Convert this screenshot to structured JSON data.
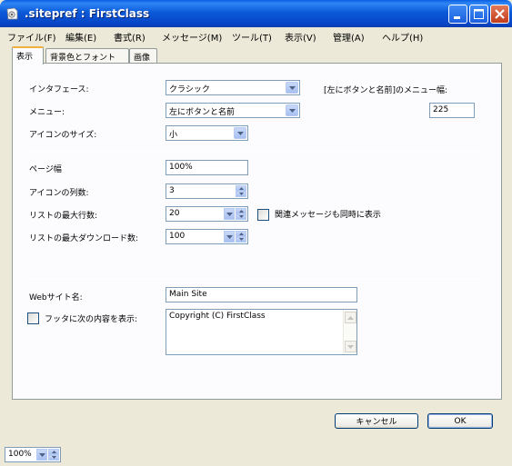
{
  "window": {
    "title": ".sitepref : FirstClass"
  },
  "menu": [
    "ファイル(F)",
    "編集(E)",
    "書式(R)",
    "メッセージ(M)",
    "ツール(T)",
    "表示(V)",
    "管理(A)",
    "ヘルプ(H)"
  ],
  "tabs": [
    "表示",
    "背景色とフォント",
    "画像"
  ],
  "display": {
    "interface_label": "インタフェース:",
    "interface_value": "クラシック",
    "menu_label": "メニュー:",
    "menu_value": "左にボタンと名前",
    "menu_width_label": "[左にボタンと名前]のメニュー幅:",
    "menu_width_value": "225",
    "icon_size_label": "アイコンのサイズ:",
    "icon_size_value": "小",
    "page_width_label": "ページ幅",
    "page_width_value": "100%",
    "icon_columns_label": "アイコンの列数:",
    "icon_columns_value": "3",
    "list_rows_label": "リストの最大行数:",
    "list_rows_value": "20",
    "related_label": "関連メッセージも同時に表示",
    "list_download_label": "リストの最大ダウンロード数:",
    "list_download_value": "100",
    "site_name_label": "Webサイト名:",
    "site_name_value": "Main Site",
    "footer_label": "フッタに次の内容を表示:",
    "footer_value": "Copyright (C) FirstClass"
  },
  "buttons": {
    "cancel": "キャンセル",
    "ok": "OK"
  },
  "status": {
    "zoom": "100%"
  }
}
